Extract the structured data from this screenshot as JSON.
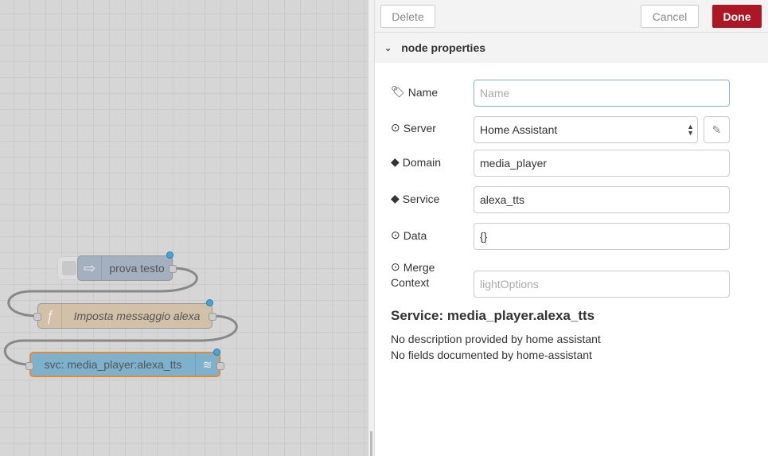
{
  "canvas": {
    "nodes": [
      {
        "label": "prova testo",
        "icon": "arrow-icon",
        "color": "#a6bbcf"
      },
      {
        "label": "Imposta messaggio alexa",
        "icon": "function-icon",
        "color": "#fdd0a2"
      },
      {
        "label": "svc: media_player:alexa_tts",
        "icon": "router-icon",
        "color": "#87bcd8"
      }
    ]
  },
  "toolbar": {
    "delete": "Delete",
    "cancel": "Cancel",
    "done": "Done"
  },
  "section": {
    "title": "node properties"
  },
  "form": {
    "name": {
      "label": "Name",
      "placeholder": "Name",
      "value": ""
    },
    "server": {
      "label": "Server",
      "value": "Home Assistant"
    },
    "domain": {
      "label": "Domain",
      "value": "media_player"
    },
    "service": {
      "label": "Service",
      "value": "alexa_tts"
    },
    "data": {
      "label": "Data",
      "value": "{}"
    },
    "merge": {
      "label1": "Merge",
      "label2": "Context",
      "placeholder": "lightOptions"
    }
  },
  "info": {
    "title": "Service: media_player.alexa_tts",
    "line1": "No description provided by home assistant",
    "line2": "No fields documented by home-assistant"
  },
  "colors": {
    "done": "#ad1625",
    "focus": "#85b4e0"
  }
}
